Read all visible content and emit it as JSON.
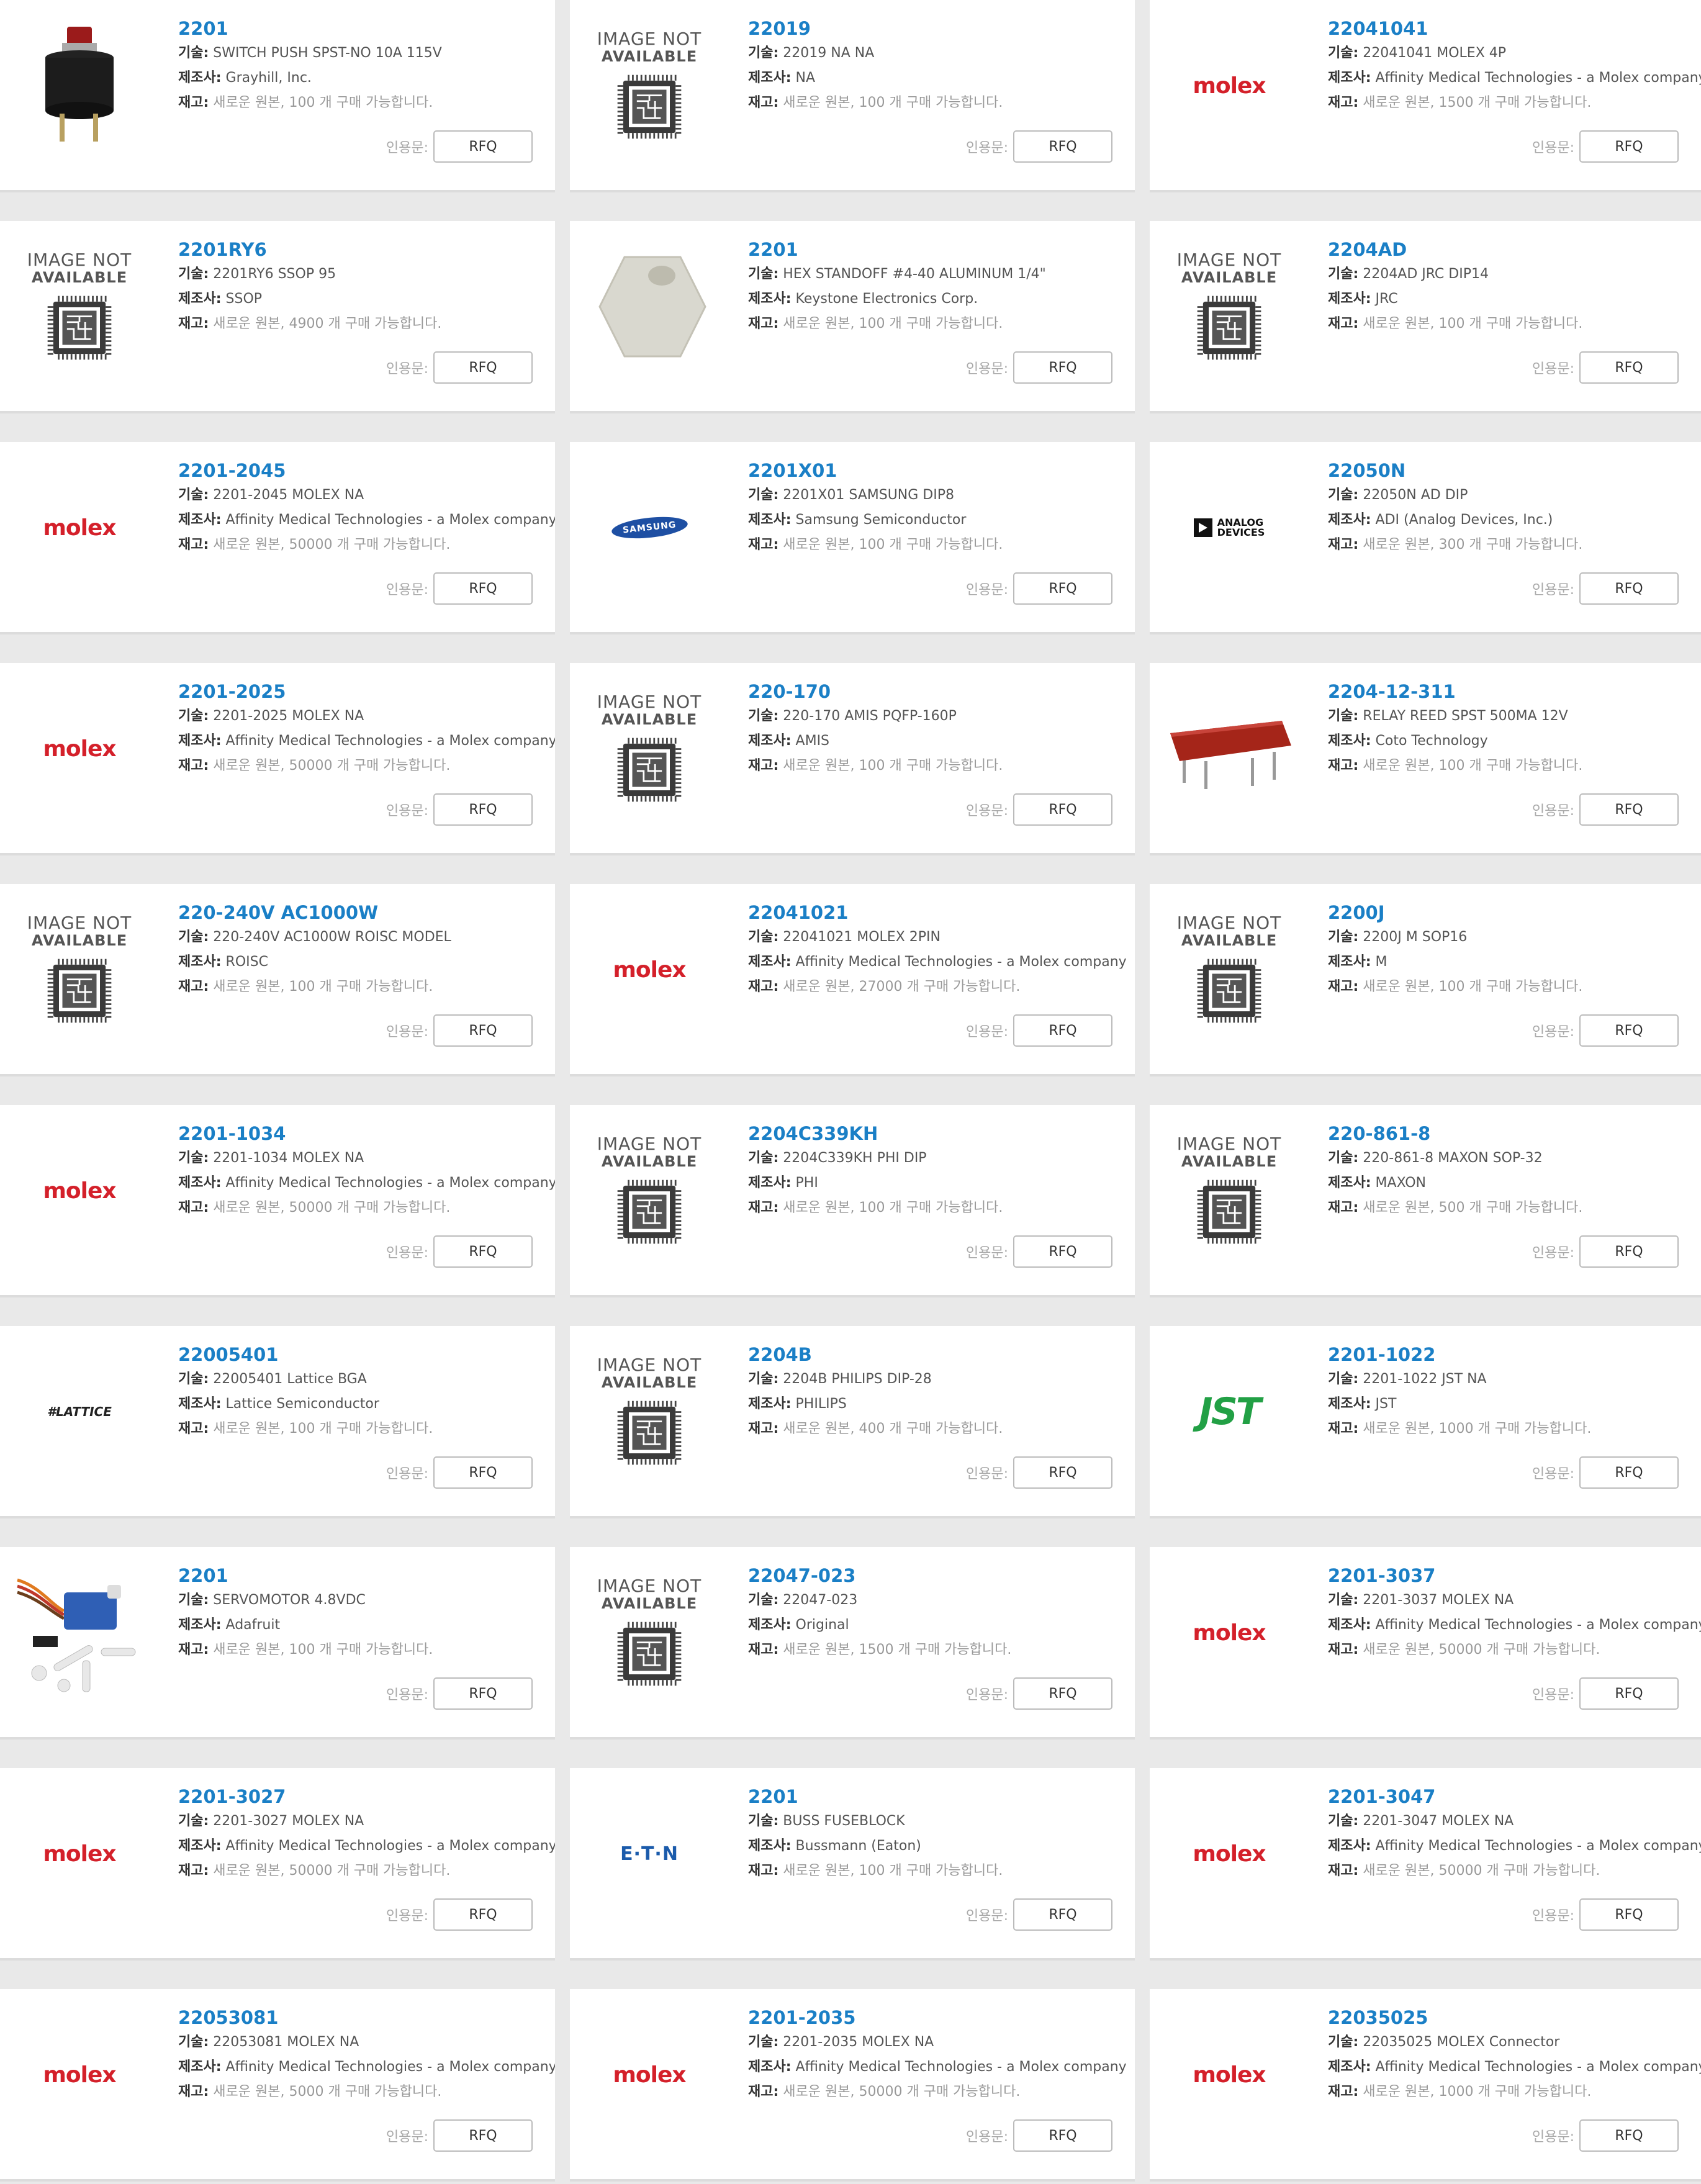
{
  "labels": {
    "desc": "기술:",
    "mfr": "제조사:",
    "stock": "재고:",
    "stock_prefix": "새로운 원본,",
    "stock_suffix": "개 구매 가능합니다.",
    "quote": "인용문:",
    "rfq": "RFQ",
    "not_available_1": "IMAGE NOT",
    "not_available_2": "AVAILABLE"
  },
  "products": [
    {
      "pn": "2201",
      "desc": "SWITCH PUSH SPST-NO 10A 115V",
      "mfr": "Grayhill, Inc.",
      "qty": "100",
      "image": "push-switch"
    },
    {
      "pn": "22019",
      "desc": "22019 NA NA",
      "mfr": "NA",
      "qty": "100",
      "image": "not-available"
    },
    {
      "pn": "22041041",
      "desc": "22041041 MOLEX 4P",
      "mfr": "Affinity Medical Technologies - a Molex company",
      "qty": "1500",
      "image": "molex",
      "logo_text": "molex"
    },
    {
      "pn": "2201RY6",
      "desc": "2201RY6 SSOP 95",
      "mfr": "SSOP",
      "qty": "4900",
      "image": "not-available"
    },
    {
      "pn": "2201",
      "desc": "HEX STANDOFF #4-40 ALUMINUM 1/4\"",
      "mfr": "Keystone Electronics Corp.",
      "qty": "100",
      "image": "hex-standoff"
    },
    {
      "pn": "2204AD",
      "desc": "2204AD JRC DIP14",
      "mfr": "JRC",
      "qty": "100",
      "image": "not-available"
    },
    {
      "pn": "2201-2045",
      "desc": "2201-2045 MOLEX NA",
      "mfr": "Affinity Medical Technologies - a Molex company",
      "qty": "50000",
      "image": "molex",
      "logo_text": "molex"
    },
    {
      "pn": "2201X01",
      "desc": "2201X01 SAMSUNG DIP8",
      "mfr": "Samsung Semiconductor",
      "qty": "100",
      "image": "samsung",
      "logo_text": "SAMSUNG"
    },
    {
      "pn": "22050N",
      "desc": "22050N AD DIP",
      "mfr": "ADI (Analog Devices, Inc.)",
      "qty": "300",
      "image": "adi",
      "logo_text": "ANALOG DEVICES"
    },
    {
      "pn": "2201-2025",
      "desc": "2201-2025 MOLEX NA",
      "mfr": "Affinity Medical Technologies - a Molex company",
      "qty": "50000",
      "image": "molex",
      "logo_text": "molex"
    },
    {
      "pn": "220-170",
      "desc": "220-170 AMIS PQFP-160P",
      "mfr": "AMIS",
      "qty": "100",
      "image": "not-available"
    },
    {
      "pn": "2204-12-311",
      "desc": "RELAY REED SPST 500MA 12V",
      "mfr": "Coto Technology",
      "qty": "100",
      "image": "reed-relay"
    },
    {
      "pn": "220-240V AC1000W",
      "desc": "220-240V AC1000W ROISC MODEL",
      "mfr": "ROISC",
      "qty": "100",
      "image": "not-available"
    },
    {
      "pn": "22041021",
      "desc": "22041021 MOLEX 2PIN",
      "mfr": "Affinity Medical Technologies - a Molex company",
      "qty": "27000",
      "image": "molex",
      "logo_text": "molex"
    },
    {
      "pn": "2200J",
      "desc": "2200J M SOP16",
      "mfr": "M",
      "qty": "100",
      "image": "not-available"
    },
    {
      "pn": "2201-1034",
      "desc": "2201-1034 MOLEX NA",
      "mfr": "Affinity Medical Technologies - a Molex company",
      "qty": "50000",
      "image": "molex",
      "logo_text": "molex"
    },
    {
      "pn": "2204C339KH",
      "desc": "2204C339KH PHI DIP",
      "mfr": "PHI",
      "qty": "100",
      "image": "not-available"
    },
    {
      "pn": "220-861-8",
      "desc": "220-861-8 MAXON SOP-32",
      "mfr": "MAXON",
      "qty": "500",
      "image": "not-available"
    },
    {
      "pn": "22005401",
      "desc": "22005401 Lattice BGA",
      "mfr": "Lattice Semiconductor",
      "qty": "100",
      "image": "lattice",
      "logo_text": "LATTICE"
    },
    {
      "pn": "2204B",
      "desc": "2204B PHILIPS DIP-28",
      "mfr": "PHILIPS",
      "qty": "400",
      "image": "not-available"
    },
    {
      "pn": "2201-1022",
      "desc": "2201-1022 JST NA",
      "mfr": "JST",
      "qty": "1000",
      "image": "jst",
      "logo_text": "JST"
    },
    {
      "pn": "2201",
      "desc": "SERVOMOTOR 4.8VDC",
      "mfr": "Adafruit",
      "qty": "100",
      "image": "servo"
    },
    {
      "pn": "22047-023",
      "desc": "22047-023",
      "mfr": "Original",
      "qty": "1500",
      "image": "not-available"
    },
    {
      "pn": "2201-3037",
      "desc": "2201-3037 MOLEX NA",
      "mfr": "Affinity Medical Technologies - a Molex company",
      "qty": "50000",
      "image": "molex",
      "logo_text": "molex"
    },
    {
      "pn": "2201-3027",
      "desc": "2201-3027 MOLEX NA",
      "mfr": "Affinity Medical Technologies - a Molex company",
      "qty": "50000",
      "image": "molex",
      "logo_text": "molex"
    },
    {
      "pn": "2201",
      "desc": "BUSS FUSEBLOCK",
      "mfr": "Bussmann (Eaton)",
      "qty": "100",
      "image": "eaton",
      "logo_text": "E·T·N"
    },
    {
      "pn": "2201-3047",
      "desc": "2201-3047 MOLEX NA",
      "mfr": "Affinity Medical Technologies - a Molex company",
      "qty": "50000",
      "image": "molex",
      "logo_text": "molex"
    },
    {
      "pn": "22053081",
      "desc": "22053081 MOLEX NA",
      "mfr": "Affinity Medical Technologies - a Molex company",
      "qty": "5000",
      "image": "molex",
      "logo_text": "molex"
    },
    {
      "pn": "2201-2035",
      "desc": "2201-2035 MOLEX NA",
      "mfr": "Affinity Medical Technologies - a Molex company",
      "qty": "50000",
      "image": "molex",
      "logo_text": "molex"
    },
    {
      "pn": "22035025",
      "desc": "22035025 MOLEX Connector",
      "mfr": "Affinity Medical Technologies - a Molex company",
      "qty": "1000",
      "image": "molex",
      "logo_text": "molex"
    }
  ]
}
